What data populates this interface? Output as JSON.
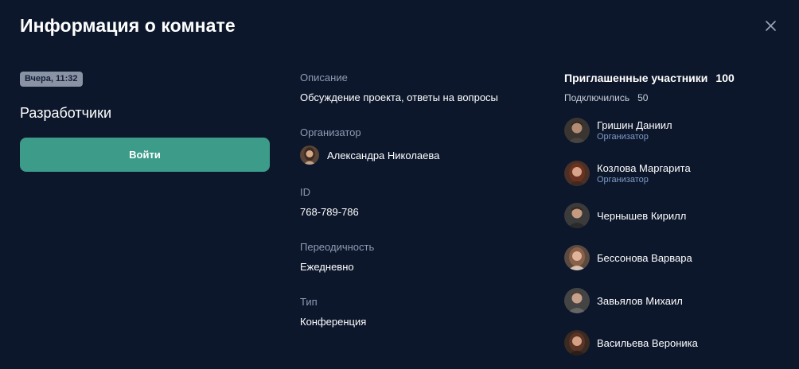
{
  "header": {
    "title": "Информация о комнате",
    "close_icon": "close-icon"
  },
  "room": {
    "timestamp": "Вчера, 11:32",
    "name": "Разработчики",
    "enter_label": "Войти"
  },
  "details": {
    "description_label": "Описание",
    "description_value": "Обсуждение проекта, ответы на вопросы",
    "organizer_label": "Организатор",
    "organizer_name": "Александра Николаева",
    "id_label": "ID",
    "id_value": "768-789-786",
    "periodicity_label": "Переодичность",
    "periodicity_value": "Ежедневно",
    "type_label": "Тип",
    "type_value": "Конференция"
  },
  "participants": {
    "title": "Приглашенные участники",
    "count": "100",
    "connected_label": "Подключились",
    "connected_count": "50",
    "list": [
      {
        "name": "Гришин Даниил",
        "role": "Организатор"
      },
      {
        "name": "Козлова Маргарита",
        "role": "Организатор"
      },
      {
        "name": "Чернышев Кирилл",
        "role": ""
      },
      {
        "name": "Бессонова Варвара",
        "role": ""
      },
      {
        "name": "Завьялов Михаил",
        "role": ""
      },
      {
        "name": "Васильева Вероника",
        "role": ""
      }
    ]
  },
  "colors": {
    "background": "#0c172b",
    "accent_button": "#3d9c89",
    "badge": "#8a93a3",
    "label": "#8f9bb3",
    "role": "#7f9bc7"
  }
}
